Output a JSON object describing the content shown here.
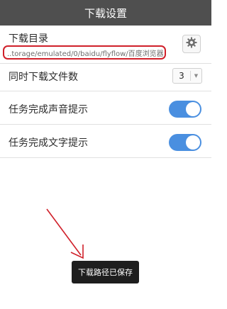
{
  "header": {
    "title": "下载设置"
  },
  "download_dir": {
    "label": "下载目录",
    "path": "..torage/emulated/0/baidu/flyflow/百度浏览器",
    "settings_icon": "gear-icon"
  },
  "simultaneous": {
    "label": "同时下载文件数",
    "value": "3",
    "arrow_icon": "triangle-down-icon"
  },
  "sound_notify": {
    "label": "任务完成声音提示",
    "enabled": true
  },
  "text_notify": {
    "label": "任务完成文字提示",
    "enabled": true
  },
  "toast": {
    "text": "下载路径已保存"
  },
  "colors": {
    "title_bar": "#4f4f4f",
    "toggle_on": "#4a8fe0",
    "highlight_box": "#d0202a",
    "annotation_arrow": "#d0202a",
    "toast_bg": "#1e1e1e"
  }
}
